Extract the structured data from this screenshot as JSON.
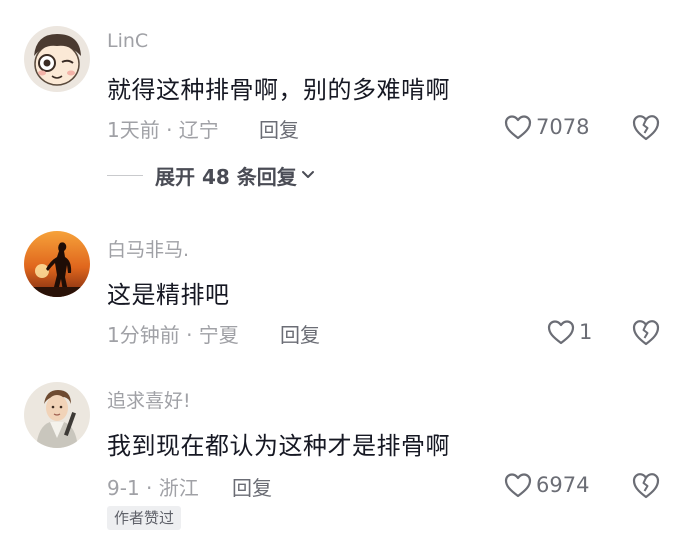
{
  "comments": [
    {
      "username": "LinC",
      "text": "就得这种排骨啊，别的多难啃啊",
      "meta": "1天前 · 辽宁",
      "reply_label": "回复",
      "likes": "7078",
      "expand_label": "展开 48 条回复"
    },
    {
      "username": "白马非马.",
      "text": "这是精排吧",
      "meta": "1分钟前 · 宁夏",
      "reply_label": "回复",
      "likes": "1"
    },
    {
      "username": "追求喜好!",
      "text": "我到现在都认为这种才是排骨啊",
      "meta": "9-1 · 浙江",
      "reply_label": "回复",
      "likes": "6974",
      "badge": "作者赞过"
    }
  ],
  "colors": {
    "username": "#a0a1a6",
    "text": "#161823",
    "meta": "#a0a1a6",
    "icon": "#6b6d75",
    "badge_bg": "#eeeff1"
  },
  "icons": [
    "heart-outline-icon",
    "broken-heart-icon",
    "chevron-down-icon"
  ]
}
